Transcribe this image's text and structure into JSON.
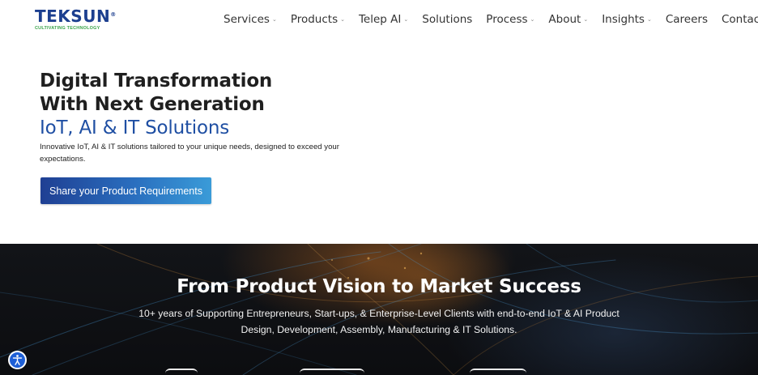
{
  "logo": {
    "name": "TEKSUN",
    "reg": "®",
    "tagline": "CULTIVATING TECHNOLOGY"
  },
  "nav": [
    {
      "label": "Services",
      "dropdown": true
    },
    {
      "label": "Products",
      "dropdown": true
    },
    {
      "label": "Telep AI",
      "dropdown": true
    },
    {
      "label": "Solutions",
      "dropdown": false
    },
    {
      "label": "Process",
      "dropdown": true
    },
    {
      "label": "About",
      "dropdown": true
    },
    {
      "label": "Insights",
      "dropdown": true
    },
    {
      "label": "Careers",
      "dropdown": false
    },
    {
      "label": "Contact",
      "dropdown": false
    }
  ],
  "hero": {
    "line1": "Digital Transformation",
    "line2": "With Next Generation",
    "line3": "IoT, AI & IT Solutions",
    "description": "Innovative IoT, AI & IT solutions tailored to your unique needs, designed to exceed your expectations.",
    "cta": "Share your Product Requirements"
  },
  "banner": {
    "title": "From Product Vision to Market Success",
    "subtitle": "10+ years of Supporting Entrepreneurs, Start-ups, & Enterprise-Level Clients with end-to-end IoT & AI Product Design, Development, Assembly, Manufacturing & IT Solutions."
  },
  "colors": {
    "brand_blue": "#1c3f8f",
    "brand_green": "#3aa44a",
    "accent_blue": "#1f4fa3",
    "a11y_blue": "#1e5fd6"
  },
  "icons": {
    "caret": "chevron-down-icon",
    "accessibility": "accessibility-icon"
  }
}
